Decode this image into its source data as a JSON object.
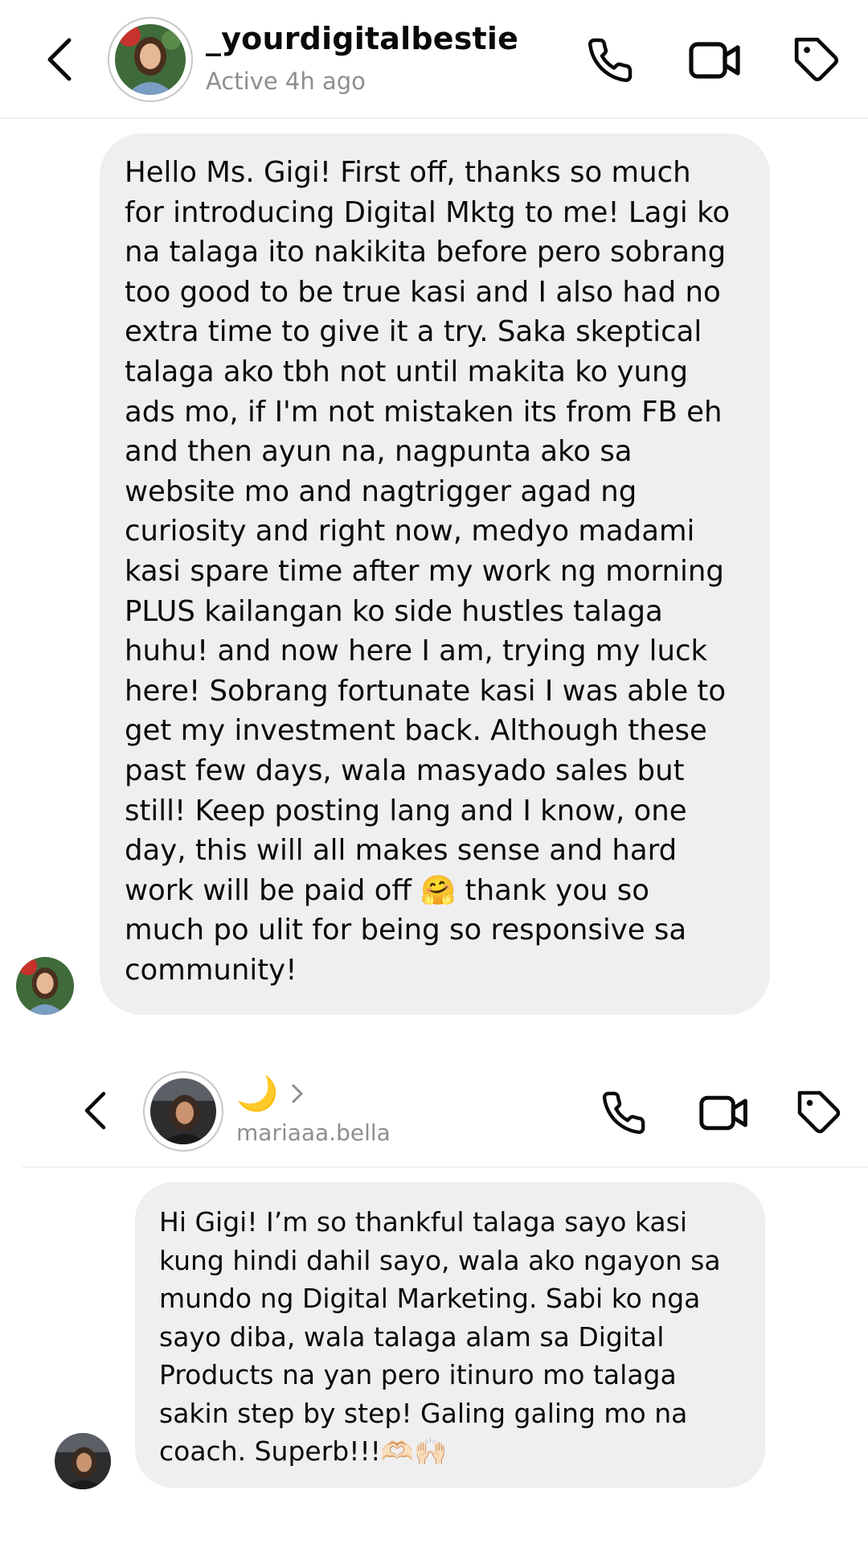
{
  "thread1": {
    "username": "_yourdigitalbestie",
    "status": "Active 4h ago",
    "message": "Hello Ms. Gigi! First off, thanks so much\nfor introducing Digital Mktg to me! Lagi ko\nna talaga ito nakikita before pero sobrang\ntoo good to be true kasi and I also had no\nextra time to give it a try. Saka skeptical\ntalaga ako tbh not until makita ko yung\nads mo, if I'm not mistaken its from FB eh\nand then ayun na, nagpunta ako sa\nwebsite mo and nagtrigger agad ng\ncuriosity and right now, medyo madami\nkasi spare time after my work ng morning\nPLUS kailangan ko side hustles talaga\nhuhu! and now here I am, trying my luck\nhere! Sobrang fortunate kasi I was able to\nget my investment back. Although these\npast few days, wala masyado sales but\nstill! Keep posting lang and I know, one\nday, this will all makes sense and hard\nwork will be paid off 🤗 thank you so\nmuch po ulit for being so responsive sa\ncommunity!"
  },
  "thread2": {
    "name_emoji": "🌙",
    "username": "mariaaa.bella",
    "message": "Hi Gigi! I’m so thankful talaga sayo kasi\nkung hindi dahil sayo, wala ako ngayon sa\nmundo ng Digital Marketing. Sabi ko nga\nsayo diba, wala talaga alam sa Digital\nProducts na yan pero itinuro mo talaga\nsakin step by step! Galing galing mo na\ncoach. Superb!!!🫶🏻🙌🏻"
  },
  "icons": {
    "back": "chevron-left-icon",
    "call": "phone-icon",
    "video": "video-camera-icon",
    "tag": "tag-icon",
    "more": "chevron-right-icon"
  },
  "colors": {
    "bubble": "#efefef",
    "subtext": "#8e8e8e",
    "divider": "#efefef",
    "avatar_ring": "#c7c7c7"
  }
}
